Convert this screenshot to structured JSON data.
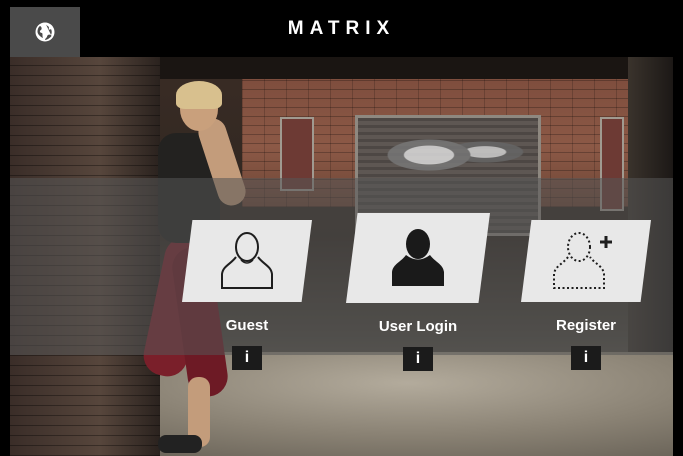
{
  "header": {
    "brand": "MATRIX",
    "globe_icon": "globe-icon"
  },
  "options": [
    {
      "key": "guest",
      "label": "Guest",
      "icon": "user-outline-icon",
      "info": "i"
    },
    {
      "key": "login",
      "label": "User Login",
      "icon": "user-filled-icon",
      "info": "i"
    },
    {
      "key": "register",
      "label": "Register",
      "icon": "user-add-icon",
      "info": "i"
    }
  ],
  "colors": {
    "topbar": "#000000",
    "globe_button": "#4a4a4a",
    "tile": "#e8e8e8",
    "info_button": "#1b1b1b"
  }
}
